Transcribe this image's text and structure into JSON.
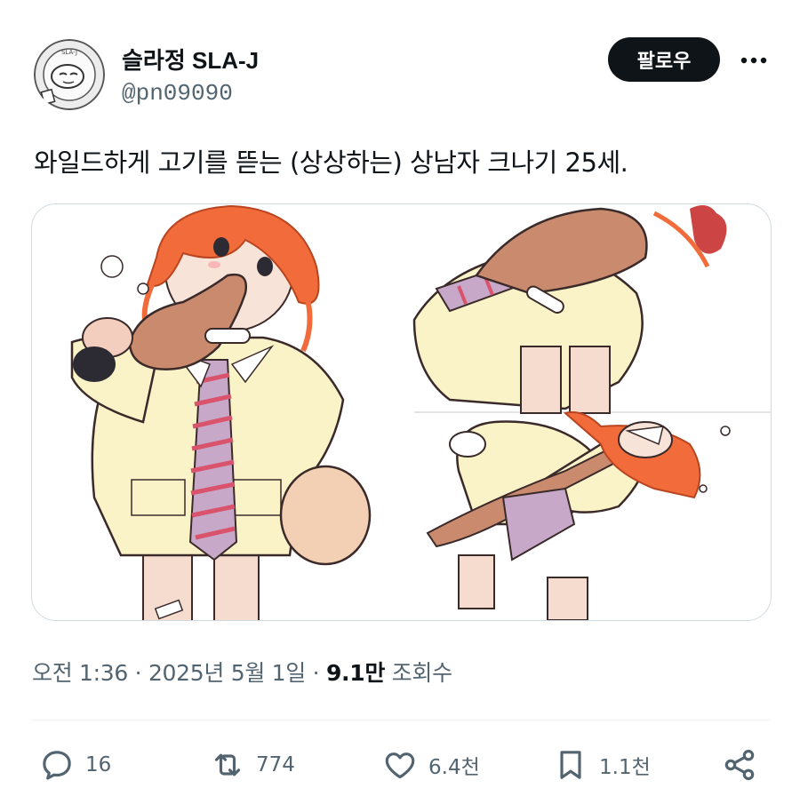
{
  "author": {
    "display_name": "슬라정 SLA-J",
    "handle": "@pn09090",
    "avatar_icon": "avatar-logo-icon",
    "avatar_seal_text": "SLA-J"
  },
  "header": {
    "follow_label": "팔로우",
    "more_icon": "more-dots-icon"
  },
  "tweet": {
    "text": "와일드하게 고기를 뜯는 (상상하는) 상남자 크나기 25세."
  },
  "meta": {
    "time": "오전 1:36",
    "separator1": " · ",
    "date": "2025년 5월 1일",
    "separator2": " · ",
    "views": "9.1만",
    "views_label": " 조회수"
  },
  "actions": {
    "reply": {
      "icon": "reply-icon",
      "count": "16"
    },
    "retweet": {
      "icon": "retweet-icon",
      "count": "774"
    },
    "like": {
      "icon": "heart-icon",
      "count": "6.4천"
    },
    "bookmark": {
      "icon": "bookmark-icon",
      "count": "1.1천"
    },
    "share": {
      "icon": "share-icon"
    }
  },
  "colors": {
    "text_primary": "#0f1419",
    "text_secondary": "#536471",
    "border": "#cfd9de",
    "follow_bg": "#0f1419",
    "follow_fg": "#ffffff",
    "hair": "#f26b3a",
    "jacket": "#fbf3c8",
    "meat": "#c98a6e",
    "tie_stripe": "#d8536b"
  }
}
